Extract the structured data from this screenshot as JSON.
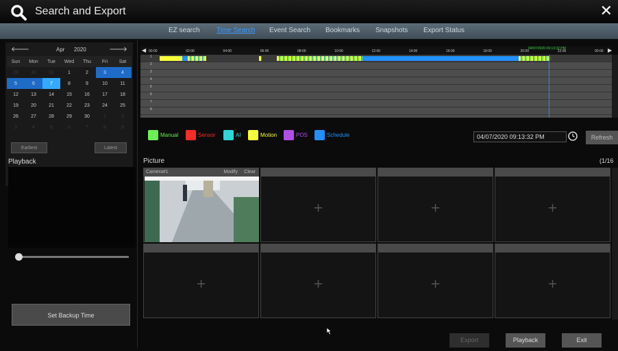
{
  "window": {
    "title": "Search and Export",
    "close_glyph": "✕",
    "search_icon": "search-icon"
  },
  "tabs": [
    {
      "label": "EZ search",
      "active": false
    },
    {
      "label": "Time Search",
      "active": true
    },
    {
      "label": "Event Search",
      "active": false
    },
    {
      "label": "Bookmarks",
      "active": false
    },
    {
      "label": "Snapshots",
      "active": false
    },
    {
      "label": "Export Status",
      "active": false
    }
  ],
  "calendar": {
    "prev_glyph": "🡐",
    "next_glyph": "🡒",
    "month": "Apr",
    "year": "2020",
    "weekdays": [
      "Sun",
      "Mon",
      "Tue",
      "Wed",
      "Thu",
      "Fri",
      "Sat"
    ],
    "weeks": [
      [
        {
          "d": "29",
          "o": 1
        },
        {
          "d": "30",
          "o": 1
        },
        {
          "d": "31",
          "o": 1
        },
        {
          "d": "1"
        },
        {
          "d": "2"
        },
        {
          "d": "3",
          "s": 1
        },
        {
          "d": "4",
          "s": 1
        }
      ],
      [
        {
          "d": "5",
          "s": 1
        },
        {
          "d": "6",
          "s": 1
        },
        {
          "d": "7",
          "c": 1
        },
        {
          "d": "8"
        },
        {
          "d": "9"
        },
        {
          "d": "10"
        },
        {
          "d": "11"
        }
      ],
      [
        {
          "d": "12"
        },
        {
          "d": "13"
        },
        {
          "d": "14"
        },
        {
          "d": "15"
        },
        {
          "d": "16"
        },
        {
          "d": "17"
        },
        {
          "d": "18"
        }
      ],
      [
        {
          "d": "19"
        },
        {
          "d": "20"
        },
        {
          "d": "21"
        },
        {
          "d": "22"
        },
        {
          "d": "23"
        },
        {
          "d": "24"
        },
        {
          "d": "25"
        }
      ],
      [
        {
          "d": "26"
        },
        {
          "d": "27"
        },
        {
          "d": "28"
        },
        {
          "d": "29"
        },
        {
          "d": "30"
        },
        {
          "d": "1",
          "o": 1
        },
        {
          "d": "2",
          "o": 1
        }
      ],
      [
        {
          "d": "3",
          "o": 1
        },
        {
          "d": "4",
          "o": 1
        },
        {
          "d": "5",
          "o": 1
        },
        {
          "d": "6",
          "o": 1
        },
        {
          "d": "7",
          "o": 1
        },
        {
          "d": "8",
          "o": 1
        },
        {
          "d": "9",
          "o": 1
        }
      ]
    ],
    "earliest_label": "Earliest",
    "latest_label": "Latest"
  },
  "playback": {
    "label": "Playback",
    "slider_position": 0,
    "backup_label": "Set Backup Time"
  },
  "timeline": {
    "ticks": [
      "00:00",
      "02:00",
      "04:00",
      "06:00",
      "08:00",
      "10:00",
      "12:00",
      "14:00",
      "16:00",
      "18:00",
      "20:00",
      "22:00",
      "00:00"
    ],
    "current_time": "04/07/2020 09:13:32 PM",
    "current_hour": 21.2256,
    "rows": [
      "1",
      "2",
      "3",
      "4",
      "5",
      "6",
      "7",
      "8"
    ],
    "recordings": [
      {
        "row": 0,
        "start": 0.3,
        "end": 1.5,
        "type": "motion"
      },
      {
        "row": 0,
        "start": 1.5,
        "end": 1.8,
        "type": "schedule"
      },
      {
        "row": 0,
        "start": 1.8,
        "end": 2.8,
        "type": "manual"
      },
      {
        "row": 0,
        "start": 5.65,
        "end": 5.8,
        "type": "manual"
      },
      {
        "row": 0,
        "start": 6.6,
        "end": 11.2,
        "type": "manual"
      },
      {
        "row": 0,
        "start": 11.2,
        "end": 19.6,
        "type": "schedule"
      },
      {
        "row": 0,
        "start": 19.6,
        "end": 21.3,
        "type": "manual"
      }
    ]
  },
  "legend": [
    {
      "label": "Manual",
      "color": "#6bf053",
      "icon": "manual-record-icon"
    },
    {
      "label": "Sensor",
      "color": "#ff2a2a",
      "icon": "sensor-alarm-icon"
    },
    {
      "label": "AI",
      "color": "#2fd6d6",
      "icon": "ai-icon"
    },
    {
      "label": "Motion",
      "color": "#f6ff3a",
      "icon": "motion-icon"
    },
    {
      "label": "POS",
      "color": "#b04fe8",
      "icon": "pos-icon"
    },
    {
      "label": "Schedule",
      "color": "#2290ff",
      "icon": "schedule-icon"
    }
  ],
  "controls": {
    "datetime": "04/07/2020 09:13:32 PM",
    "refresh_label": "Refresh"
  },
  "picture": {
    "label": "Picture",
    "page": "(1/16",
    "cells": [
      {
        "camera": "Camera#1",
        "modify": "Modify",
        "clear": "Clear",
        "has_image": true
      },
      {
        "camera": "",
        "has_image": false
      },
      {
        "camera": "",
        "has_image": false
      },
      {
        "camera": "",
        "has_image": false
      },
      {
        "camera": "",
        "has_image": false
      },
      {
        "camera": "",
        "has_image": false
      },
      {
        "camera": "",
        "has_image": false
      },
      {
        "camera": "",
        "has_image": false
      }
    ],
    "plus_glyph": "+"
  },
  "footer": {
    "export_label": "Export",
    "playback_label": "Playback",
    "exit_label": "Exit"
  }
}
